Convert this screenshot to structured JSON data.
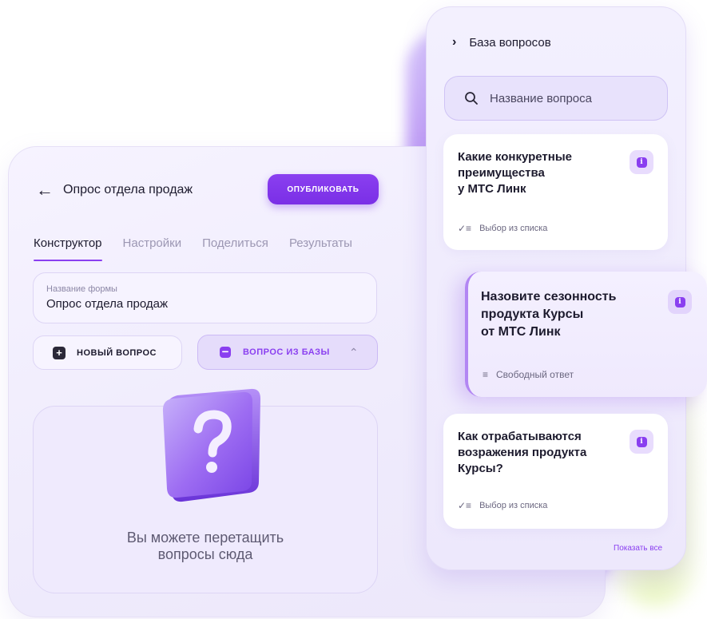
{
  "colors": {
    "accent": "#8a3ff0",
    "text": "#1d1b2e",
    "muted": "#9c97b3",
    "panel_bg": "#f3f0fe"
  },
  "constructor": {
    "back_icon": "arrow-left-icon",
    "title": "Опрос отдела продаж",
    "publish_label": "ОПУБЛИКОВАТЬ",
    "tabs": [
      {
        "label": "Конструктор",
        "active": true
      },
      {
        "label": "Настройки",
        "active": false
      },
      {
        "label": "Поделиться",
        "active": false
      },
      {
        "label": "Результаты",
        "active": false
      }
    ],
    "form_name": {
      "label": "Название формы",
      "value": "Опрос отдела продаж"
    },
    "new_question": {
      "icon": "plus-square-icon",
      "label": "НОВЫЙ ВОПРОС"
    },
    "from_base": {
      "icon": "database-icon",
      "label": "ВОПРОС ИЗ БАЗЫ",
      "chevron": "chevron-up-icon"
    },
    "drop_zone": {
      "icon": "question-mark-cube-icon",
      "line1": "Вы можете перетащить",
      "line2": "вопросы сюда"
    }
  },
  "question_base": {
    "title": "База вопросов",
    "search_placeholder": "Название вопроса",
    "questions": [
      {
        "title_lines": [
          "Какие конкуретные",
          "преимущества",
          "у МТС Линк"
        ],
        "type": "Выбор из списка",
        "type_icon": "checklist-icon"
      },
      {
        "title_lines": [
          "Назовите сезонность",
          "продукта Курсы",
          "от МТС Линк"
        ],
        "type": "Свободный ответ",
        "type_icon": "list-icon"
      },
      {
        "title_lines": [
          "Как отрабатываются",
          "возражения продукта",
          "Курсы?"
        ],
        "type": "Выбор из списка",
        "type_icon": "checklist-icon"
      }
    ],
    "show_all": "Показать все"
  }
}
